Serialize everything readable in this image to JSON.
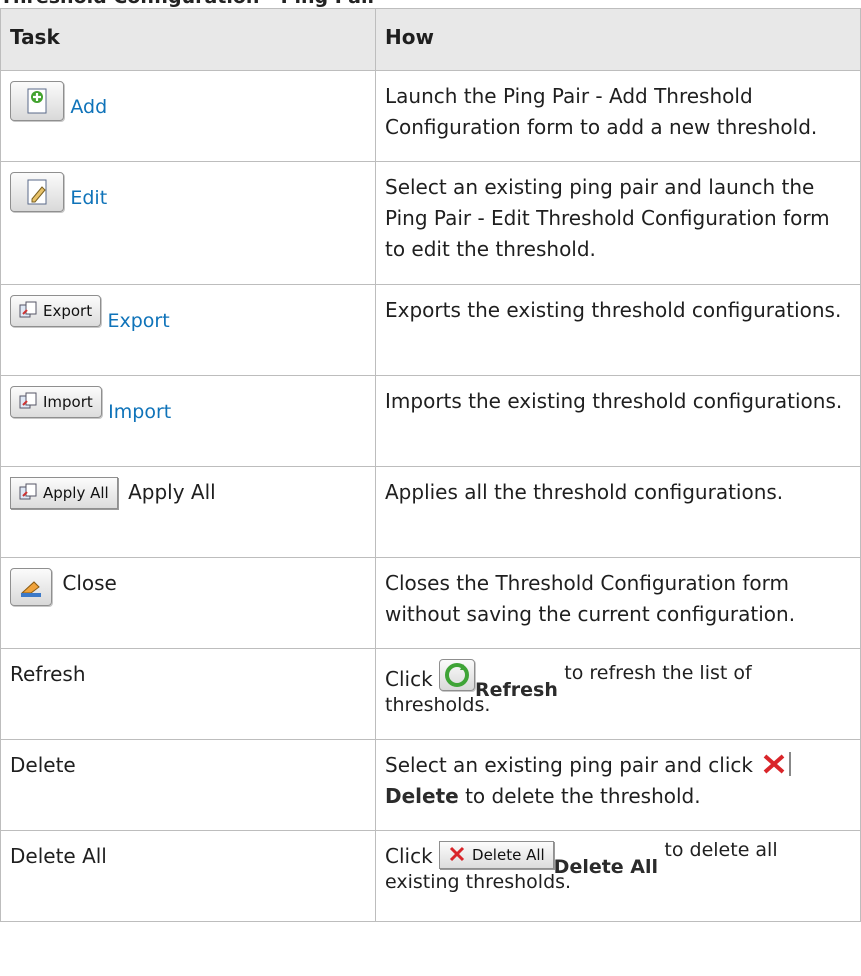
{
  "top_text": "Threshold Configuration - Ping Pair",
  "headers": {
    "task": "Task",
    "how": "How"
  },
  "rows": [
    {
      "task": "Add",
      "button": "",
      "how": "Launch the Ping Pair - Add Threshold Configuration form to add a new threshold."
    },
    {
      "task": "Edit",
      "button": "",
      "how": "Select an existing ping pair and launch the Ping Pair - Edit Threshold Configuration form to edit the threshold."
    },
    {
      "task": "Export",
      "button": "Export",
      "how": "Exports the existing threshold configurations."
    },
    {
      "task": "Import",
      "button": "Import",
      "how": "Imports the existing threshold configurations."
    },
    {
      "task": "Apply All",
      "button": "Apply All",
      "how": "Applies all the threshold configurations."
    },
    {
      "task": "Close",
      "button": "",
      "how": "Closes the Threshold Configuration form without saving the current configuration."
    },
    {
      "task": "Refresh",
      "how_pre": "Click",
      "how_bold": "Refresh",
      "how_post": "to refresh the list of thresholds."
    },
    {
      "task": "Delete",
      "how_pre": "Select an existing ping pair and click",
      "how_bold": "Delete",
      "how_post": "to delete the threshold."
    },
    {
      "task": "Delete All",
      "how_pre": "Click",
      "button": "Delete All",
      "how_bold": "Delete All",
      "how_post": "to delete all existing thresholds."
    }
  ],
  "colors": {
    "link": "#0f73b9",
    "header_bg": "#e8e8e8",
    "border": "#bdbdbd"
  },
  "icons": [
    "add-icon",
    "edit-icon",
    "export-icon",
    "import-icon",
    "apply-all-icon",
    "close-icon",
    "refresh-icon",
    "delete-icon",
    "delete-all-icon"
  ]
}
